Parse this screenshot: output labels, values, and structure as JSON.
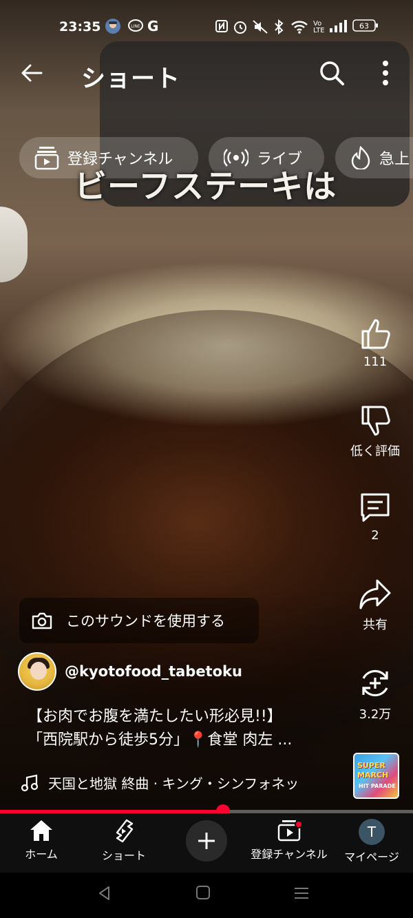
{
  "status_bar": {
    "time": "23:35",
    "left_icons": [
      "avatar-notification-icon",
      "line-app-icon",
      "google-icon"
    ],
    "right_icons": [
      "nfc-icon",
      "alarm-icon",
      "mute-icon",
      "bluetooth-icon",
      "wifi-icon",
      "volte-icon",
      "signal-icon",
      "battery-icon"
    ],
    "line_label": "LINE",
    "google_label": "G",
    "volte_label": "Vo LTE",
    "battery": "63"
  },
  "header": {
    "title": "ショート"
  },
  "chips": [
    {
      "label": "登録チャンネル",
      "icon": "subscriptions-icon"
    },
    {
      "label": "ライブ",
      "icon": "live-icon"
    },
    {
      "label": "急上",
      "icon": "trending-icon"
    }
  ],
  "video": {
    "overlay_text": "ビーフステーキは"
  },
  "actions": {
    "like_count": "111",
    "dislike_label": "低く評価",
    "comment_count": "2",
    "share_label": "共有",
    "remix_count": "3.2万"
  },
  "sound_chip": {
    "label": "このサウンドを使用する"
  },
  "channel": {
    "handle": "@kyotofood_tabetoku"
  },
  "description": {
    "line1": "【お肉でお腹を満たしたい形必見!!】",
    "line2": "「西院駅から徒歩5分」📍食堂 肉左 ..."
  },
  "music": {
    "track": "天国と地獄 終曲 · キング・シンフォネッ"
  },
  "album": {
    "line1": "SUPER",
    "line2": "MARCH",
    "line3": "HIT PARADE"
  },
  "progress": {
    "fraction": 0.54
  },
  "colors": {
    "accent": "#ff0033",
    "nav_bg": "#0f0f0f"
  },
  "bottom_nav": {
    "home": "ホーム",
    "shorts": "ショート",
    "subscriptions": "登録チャンネル",
    "you": "マイページ",
    "you_initial": "T"
  }
}
